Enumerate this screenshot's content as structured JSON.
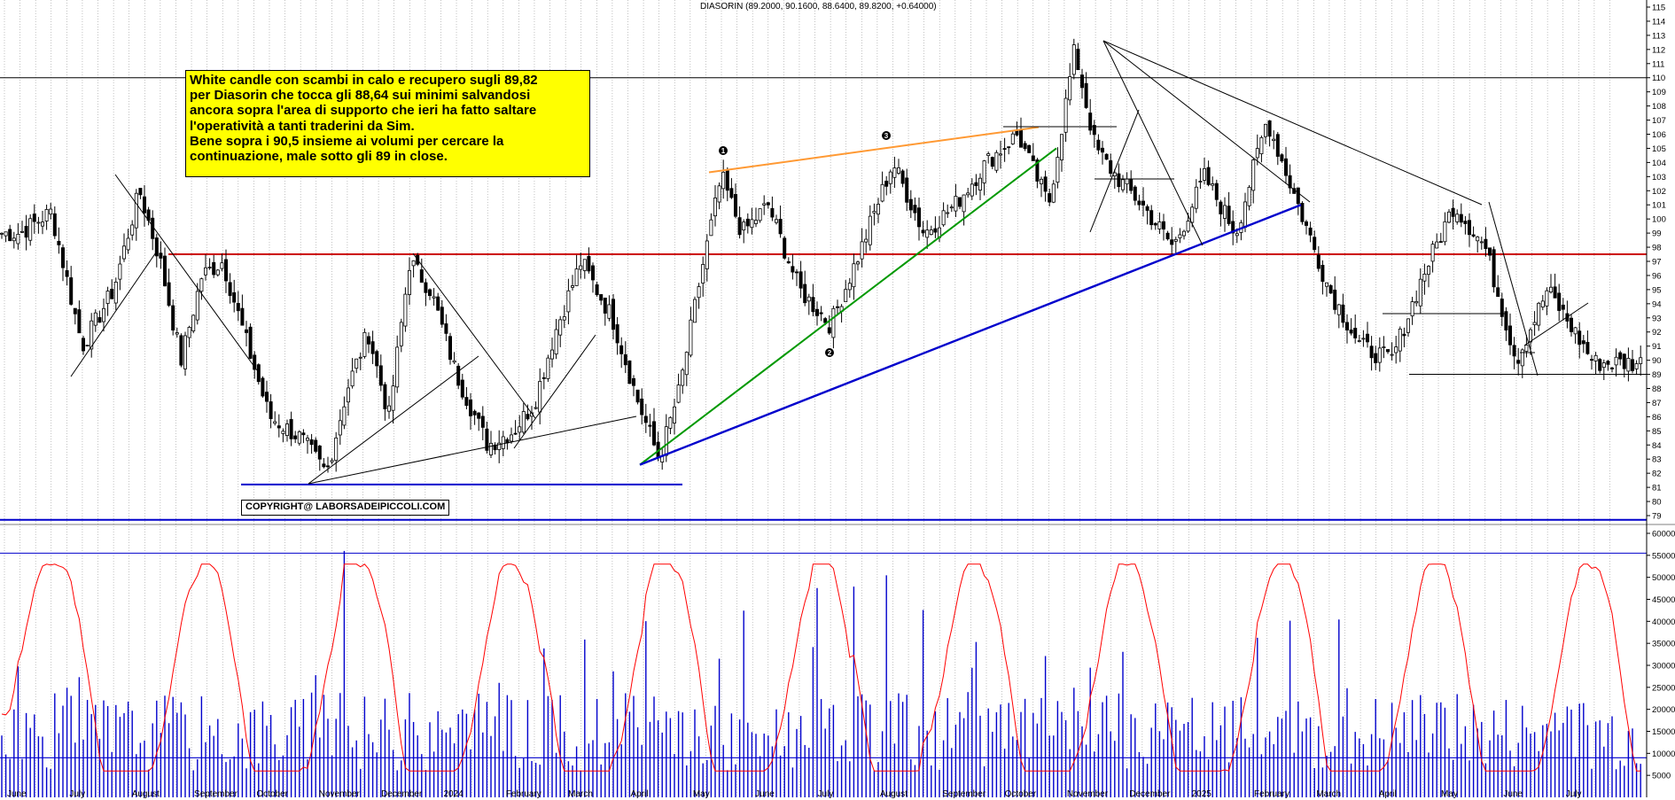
{
  "header": {
    "quote": "DIASORIN (89.2000, 90.1600, 88.6400, 89.8200, +0.64000)"
  },
  "annotation": {
    "lines": [
      "White candle con scambi in calo e recupero sugli 89,82",
      "per Diasorin che tocca gli 88,64 sui minimi salvandosi",
      "ancora sopra l'area di supporto che ieri ha fatto saltare",
      "l'operatività a tanti traderini da Sim.",
      "Bene sopra i 90,5 insieme ai volumi per cercare la",
      "continuazione, male sotto gli 89 in close."
    ]
  },
  "copyright": "COPYRIGHT@ LABORSADEIPICCOLI.COM",
  "wave_labels": [
    "1",
    "2",
    "3"
  ],
  "chart_data": {
    "type": "candlestick",
    "price_axis": {
      "range": [
        79,
        115
      ],
      "ticks": [
        79,
        80,
        81,
        82,
        83,
        84,
        85,
        86,
        87,
        88,
        89,
        90,
        91,
        92,
        93,
        94,
        95,
        96,
        97,
        98,
        99,
        100,
        101,
        102,
        103,
        104,
        105,
        106,
        107,
        108,
        109,
        110,
        111,
        112,
        113,
        114,
        115
      ]
    },
    "volume_axis": {
      "range": [
        0,
        60000
      ],
      "ticks": [
        "5000",
        "10000",
        "15000",
        "20000",
        "25000",
        "30000",
        "35000",
        "40000",
        "45000",
        "50000",
        "55000",
        "60000"
      ]
    },
    "x_months": [
      "June",
      "July",
      "August",
      "September",
      "October",
      "November",
      "December",
      "2024",
      "February",
      "March",
      "April",
      "May",
      "June",
      "July",
      "August",
      "September",
      "October",
      "November",
      "December",
      "2025",
      "February",
      "March",
      "April",
      "May",
      "June",
      "July"
    ],
    "price_path": [
      [
        "June",
        99
      ],
      [
        "June",
        100.5
      ],
      [
        "July",
        91
      ],
      [
        "July",
        95
      ],
      [
        "August",
        102
      ],
      [
        "August",
        97
      ],
      [
        "August",
        90
      ],
      [
        "September",
        96
      ],
      [
        "September",
        97
      ],
      [
        "September",
        92
      ],
      [
        "October",
        86
      ],
      [
        "October",
        84.5
      ],
      [
        "November",
        82
      ],
      [
        "November",
        88
      ],
      [
        "November",
        92
      ],
      [
        "December",
        86
      ],
      [
        "December",
        97
      ],
      [
        "December",
        95
      ],
      [
        "2024",
        89
      ],
      [
        "2024",
        84
      ],
      [
        "February",
        85
      ],
      [
        "February",
        87
      ],
      [
        "February",
        92
      ],
      [
        "March",
        97
      ],
      [
        "March",
        93
      ],
      [
        "April",
        87
      ],
      [
        "April",
        83
      ],
      [
        "April",
        88
      ],
      [
        "May",
        96
      ],
      [
        "May",
        103
      ],
      [
        "May",
        99
      ],
      [
        "June",
        101
      ],
      [
        "June",
        95
      ],
      [
        "July",
        92.5
      ],
      [
        "July",
        98
      ],
      [
        "August",
        104
      ],
      [
        "August",
        99
      ],
      [
        "September",
        101
      ],
      [
        "September",
        104
      ],
      [
        "October",
        106
      ],
      [
        "October",
        101
      ],
      [
        "November",
        112
      ],
      [
        "November",
        105
      ],
      [
        "November",
        103
      ],
      [
        "December",
        101
      ],
      [
        "December",
        98
      ],
      [
        "2025",
        103
      ],
      [
        "2025",
        99
      ],
      [
        "February",
        107
      ],
      [
        "February",
        101
      ],
      [
        "March",
        95
      ],
      [
        "March",
        91
      ],
      [
        "April",
        90
      ],
      [
        "April",
        96
      ],
      [
        "May",
        101
      ],
      [
        "May",
        98
      ],
      [
        "June",
        90
      ],
      [
        "June",
        95
      ],
      [
        "July",
        89.82
      ]
    ],
    "horizontal_levels": [
      110,
      97.5,
      89,
      81.2,
      78.7
    ],
    "trendlines": [
      {
        "name": "orange",
        "from": [
          "May",
          103.3
        ],
        "to": [
          "October",
          106.5
        ]
      },
      {
        "name": "green",
        "from": [
          "April",
          82.6
        ],
        "to": [
          "October",
          105
        ]
      },
      {
        "name": "blue",
        "from": [
          "April",
          82.6
        ],
        "to": [
          "February",
          101
        ]
      }
    ],
    "volume_level": 9000,
    "volume_high_level": 55500,
    "series": [
      {
        "name": "volume",
        "type": "bar"
      },
      {
        "name": "volume average",
        "type": "line"
      }
    ],
    "colors": {
      "up": "#ffffff",
      "down": "#000000",
      "support": "#0000cc",
      "resistance": "#cc0000",
      "orange": "#ff9933",
      "green": "#009900",
      "volume": "#0000cc",
      "average": "#ff0000"
    }
  }
}
